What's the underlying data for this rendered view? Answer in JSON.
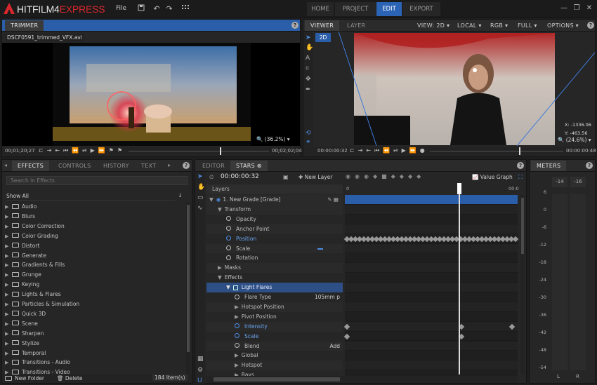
{
  "app": {
    "logo_main": "HITFILM4",
    "logo_accent": "EXPRESS",
    "menu_file": "File",
    "nav_tabs": [
      "HOME",
      "PROJECT",
      "EDIT",
      "EXPORT"
    ],
    "active_nav": "EDIT"
  },
  "trimmer": {
    "tab": "TRIMMER",
    "filename": "DSCF0591_trimmed_VFX.avi",
    "zoom": "(36.2%)",
    "time_start": "00;01;20;27",
    "time_end": "00;02;02;04"
  },
  "viewer": {
    "tabs": [
      "VIEWER",
      "LAYER"
    ],
    "badge_2d": "2D",
    "view_mode": "VIEW: 2D",
    "space": "LOCAL",
    "channel": "RGB",
    "quality": "FULL",
    "options": "OPTIONS",
    "coord_x": "X: -1336.06",
    "coord_y": "Y: -463.56",
    "zoom": "(24.6%)",
    "time_start": "00:00:00:32",
    "time_end": "00:00:00:48"
  },
  "effects_panel": {
    "tabs": [
      "EFFECTS",
      "CONTROLS",
      "HISTORY",
      "TEXT"
    ],
    "search_placeholder": "Search in Effects",
    "filter": "Show All",
    "categories": [
      "Audio",
      "Blurs",
      "Color Correction",
      "Color Grading",
      "Distort",
      "Generate",
      "Gradients & Fills",
      "Grunge",
      "Keying",
      "Lights & Flares",
      "Particles & Simulation",
      "Quick 3D",
      "Scene",
      "Sharpen",
      "Stylize",
      "Temporal",
      "Transitions - Audio",
      "Transitions - Video"
    ],
    "new_folder": "New Folder",
    "delete": "Delete",
    "item_count": "184 Item(s)"
  },
  "editor": {
    "tabs": [
      "EDITOR",
      "STARS"
    ],
    "timecode": "00:00:00:32",
    "new_layer": "New Layer",
    "value_graph": "Value Graph",
    "layers_header": "Layers",
    "ruler_start": "0",
    "ruler_end": "00:0",
    "rows": [
      {
        "label": "1. New Grade [Grade]",
        "indent": 0,
        "kind": "layer"
      },
      {
        "label": "Transform",
        "indent": 1,
        "kind": "group-open"
      },
      {
        "label": "Opacity",
        "indent": 2,
        "kind": "prop"
      },
      {
        "label": "Anchor Point",
        "indent": 2,
        "kind": "prop"
      },
      {
        "label": "Position",
        "indent": 2,
        "kind": "prop-active"
      },
      {
        "label": "Scale",
        "indent": 2,
        "kind": "prop"
      },
      {
        "label": "Rotation",
        "indent": 2,
        "kind": "prop"
      },
      {
        "label": "Masks",
        "indent": 1,
        "kind": "group-closed"
      },
      {
        "label": "Effects",
        "indent": 1,
        "kind": "group-open"
      },
      {
        "label": "Light Flares",
        "indent": 2,
        "kind": "effect"
      },
      {
        "label": "Flare Type",
        "indent": 3,
        "kind": "prop",
        "value": "105mm p"
      },
      {
        "label": "Hotspot Position",
        "indent": 3,
        "kind": "group-closed"
      },
      {
        "label": "Pivot Position",
        "indent": 3,
        "kind": "group-closed"
      },
      {
        "label": "Intensity",
        "indent": 3,
        "kind": "prop-active"
      },
      {
        "label": "Scale",
        "indent": 3,
        "kind": "prop-active"
      },
      {
        "label": "Blend",
        "indent": 3,
        "kind": "prop",
        "value": "Add"
      },
      {
        "label": "Global",
        "indent": 3,
        "kind": "group-closed"
      },
      {
        "label": "Hotspot",
        "indent": 3,
        "kind": "group-closed"
      },
      {
        "label": "Rays",
        "indent": 3,
        "kind": "group-closed"
      }
    ]
  },
  "meters": {
    "tab": "METERS",
    "peak_left": "-14",
    "peak_right": "-16",
    "scale": [
      "6",
      "0",
      "-6",
      "-12",
      "-18",
      "-24",
      "-30",
      "-36",
      "-42",
      "-48",
      "-54"
    ],
    "ch_left": "L",
    "ch_right": "R"
  },
  "colors": {
    "accent": "#2c64b5",
    "brand_red": "#d8282d",
    "bg": "#1e1e1e"
  }
}
